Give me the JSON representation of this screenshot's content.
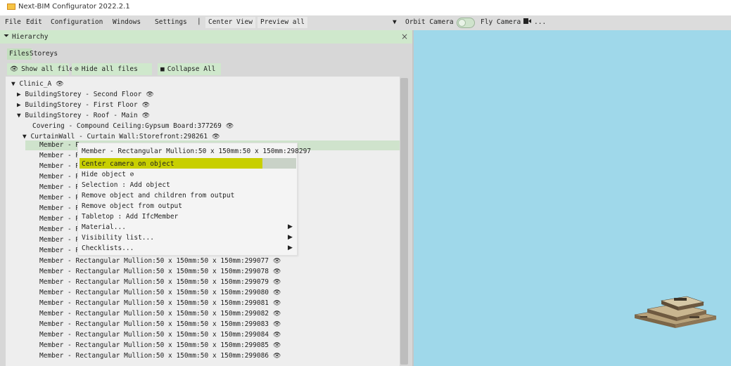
{
  "window": {
    "title": "Next-BIM Configurator 2022.2.1"
  },
  "menubar": {
    "items": [
      "File",
      "Edit",
      "Configuration",
      "Windows",
      "Settings"
    ],
    "separator": "|",
    "center_view": "Center View",
    "preview_all": "Preview all",
    "orbit_camera": "Orbit Camera",
    "fly_camera": "Fly Camera",
    "more": "..."
  },
  "panel": {
    "title": "Hierarchy",
    "tabs": [
      "Files",
      "Storeys"
    ],
    "buttons": {
      "show_all": "Show all files",
      "hide_all": "Hide all files",
      "collapse_all": "Collapse All"
    }
  },
  "tree": {
    "root": "Clinic_A",
    "storey_second": "BuildingStorey - Second Floor",
    "storey_first": "BuildingStorey - First Floor",
    "storey_roof": "BuildingStorey - Roof - Main",
    "covering": "Covering - Compound Ceiling:Gypsum Board:377269",
    "curtain_wall": "CurtainWall - Curtain Wall:Storefront:298261",
    "member_prefix": "Member - R",
    "members": [
      "Member - Rectangular Mullion:50 x 150mm:50 x 150mm:299077",
      "Member - Rectangular Mullion:50 x 150mm:50 x 150mm:299078",
      "Member - Rectangular Mullion:50 x 150mm:50 x 150mm:299079",
      "Member - Rectangular Mullion:50 x 150mm:50 x 150mm:299080",
      "Member - Rectangular Mullion:50 x 150mm:50 x 150mm:299081",
      "Member - Rectangular Mullion:50 x 150mm:50 x 150mm:299082",
      "Member - Rectangular Mullion:50 x 150mm:50 x 150mm:299083",
      "Member - Rectangular Mullion:50 x 150mm:50 x 150mm:299084",
      "Member - Rectangular Mullion:50 x 150mm:50 x 150mm:299085",
      "Member - Rectangular Mullion:50 x 150mm:50 x 150mm:299086"
    ]
  },
  "context_menu": {
    "header": "Member - Rectangular Mullion:50 x 150mm:50 x 150mm:298297",
    "items": [
      "Center camera on object",
      "Hide object",
      "Selection : Add object",
      "Remove object and children from output",
      "Remove object from output",
      "Tabletop : Add IfcMember",
      "Material...",
      "Visibility list...",
      "Checklists..."
    ]
  },
  "colors": {
    "accent_green": "#cfe8cc",
    "menu_highlight": "#c8cf00",
    "viewport_sky": "#9fd8ea"
  }
}
